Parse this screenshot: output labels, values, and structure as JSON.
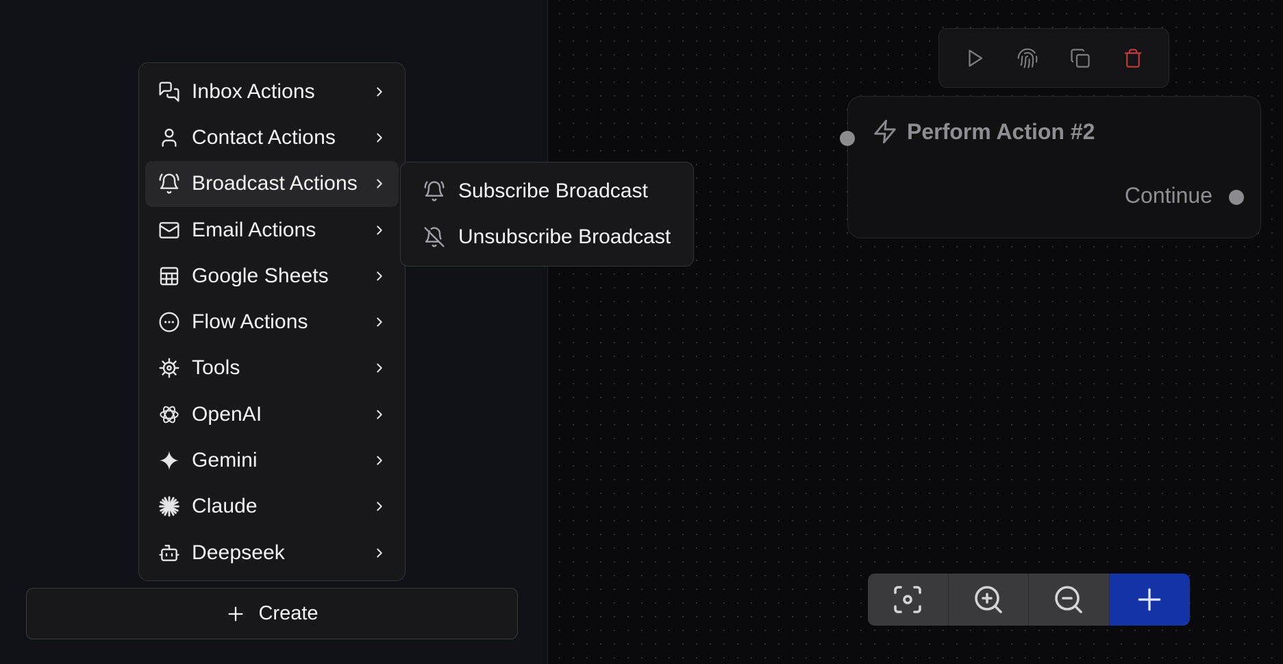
{
  "menu": {
    "items": [
      {
        "label": "Inbox Actions",
        "icon": "chat-bubbles-icon"
      },
      {
        "label": "Contact Actions",
        "icon": "user-icon"
      },
      {
        "label": "Broadcast Actions",
        "icon": "bell-ring-icon",
        "active": true
      },
      {
        "label": "Email Actions",
        "icon": "mail-icon"
      },
      {
        "label": "Google Sheets",
        "icon": "sheet-icon"
      },
      {
        "label": "Flow Actions",
        "icon": "more-circle-icon"
      },
      {
        "label": "Tools",
        "icon": "cog-icon"
      },
      {
        "label": "OpenAI",
        "icon": "openai-icon"
      },
      {
        "label": "Gemini",
        "icon": "gemini-sparkle-icon"
      },
      {
        "label": "Claude",
        "icon": "claude-burst-icon"
      },
      {
        "label": "Deepseek",
        "icon": "bot-icon"
      }
    ]
  },
  "submenu": {
    "items": [
      {
        "label": "Subscribe Broadcast",
        "icon": "bell-ring-icon"
      },
      {
        "label": "Unsubscribe Broadcast",
        "icon": "bell-off-icon"
      }
    ]
  },
  "create": {
    "label": "Create"
  },
  "node": {
    "title": "Perform Action #2",
    "output_label": "Continue"
  },
  "colors": {
    "accent": "#1433a6",
    "danger": "#c0393b",
    "panel": "#18181b"
  }
}
